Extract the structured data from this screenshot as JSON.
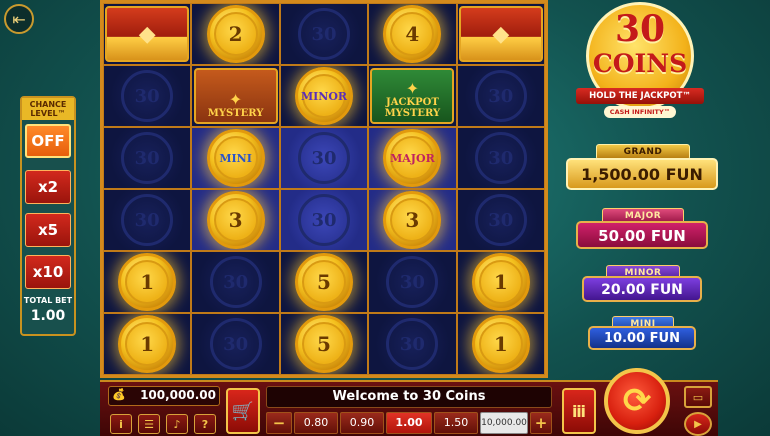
{
  "chance_level": {
    "title": "CHANCE LEVEL™",
    "options": [
      "OFF",
      "x2",
      "x5",
      "x10"
    ],
    "selected": "OFF",
    "total_bet_label": "TOTAL BET",
    "total_bet_value": "1.00"
  },
  "grid": {
    "rows": [
      [
        {
          "type": "chest"
        },
        {
          "type": "coin",
          "label": "2"
        },
        {
          "type": "empty",
          "label": "30"
        },
        {
          "type": "coin",
          "label": "4"
        },
        {
          "type": "chest"
        }
      ],
      [
        {
          "type": "empty",
          "label": "30"
        },
        {
          "type": "mystery",
          "label": "MYSTERY"
        },
        {
          "type": "coin",
          "label": "MINOR",
          "word": "minor"
        },
        {
          "type": "jackpot",
          "label": "JACKPOT MYSTERY"
        },
        {
          "type": "empty",
          "label": "30"
        }
      ],
      [
        {
          "type": "empty",
          "label": "30"
        },
        {
          "type": "coin",
          "label": "MINI",
          "word": "mini",
          "lit": true
        },
        {
          "type": "empty",
          "label": "30",
          "lit": true
        },
        {
          "type": "coin",
          "label": "MAJOR",
          "word": "major",
          "lit": true
        },
        {
          "type": "empty",
          "label": "30"
        }
      ],
      [
        {
          "type": "empty",
          "label": "30"
        },
        {
          "type": "coin",
          "label": "3",
          "lit": true
        },
        {
          "type": "empty",
          "label": "30",
          "lit": true
        },
        {
          "type": "coin",
          "label": "3",
          "lit": true
        },
        {
          "type": "empty",
          "label": "30"
        }
      ],
      [
        {
          "type": "coin",
          "label": "1"
        },
        {
          "type": "empty",
          "label": "30"
        },
        {
          "type": "coin",
          "label": "5"
        },
        {
          "type": "empty",
          "label": "30"
        },
        {
          "type": "coin",
          "label": "1"
        }
      ],
      [
        {
          "type": "coin",
          "label": "1"
        },
        {
          "type": "empty",
          "label": "30"
        },
        {
          "type": "coin",
          "label": "5"
        },
        {
          "type": "empty",
          "label": "30"
        },
        {
          "type": "coin",
          "label": "1"
        }
      ]
    ]
  },
  "logo": {
    "number": "30",
    "word": "COINS",
    "ribbon": "HOLD THE JACKPOT™",
    "sub": "CASH INFINITY™"
  },
  "jackpots": {
    "grand": {
      "label": "GRAND",
      "value": "1,500.00 FUN"
    },
    "major": {
      "label": "MAJOR",
      "value": "50.00 FUN"
    },
    "minor": {
      "label": "MINOR",
      "value": "20.00 FUN"
    },
    "mini": {
      "label": "MINI",
      "value": "10.00 FUN"
    }
  },
  "bottom": {
    "balance": "100,000.00",
    "message": "Welcome to 30 Coins",
    "bets": [
      "0.80",
      "0.90",
      "1.00",
      "1.50",
      "10,000.00"
    ],
    "selected_bet": "1.00",
    "minus": "−",
    "plus": "+",
    "icons": {
      "exit": "exit-icon",
      "balance": "money-bag-icon",
      "info": "info-icon",
      "menu": "menu-icon",
      "sound": "sound-icon",
      "help": "help-icon",
      "shop": "shop-cart-icon",
      "spin": "spin-arrows-icon",
      "autoplay": "autoplay-icon",
      "turbo": "turbo-icon",
      "play": "play-icon"
    }
  },
  "colors": {
    "background": "#12524f",
    "grid_bg": "#0e1540",
    "grid_border": "#d48a1c",
    "coin_gold": "#f5c21f",
    "red_button": "#d8261b",
    "grand": "#e8b43a",
    "major": "#c0235e",
    "minor": "#6a34c8",
    "mini": "#2f5fe0"
  }
}
